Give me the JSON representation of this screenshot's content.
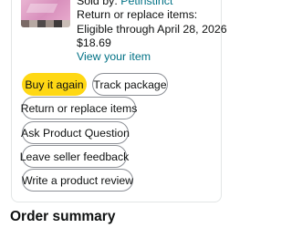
{
  "order_item": {
    "image_alt": "product-thumbnail",
    "sold_by_label": "Sold by: ",
    "seller_name": "Petinstinct",
    "return_line1": "Return or replace items:",
    "return_line2": "Eligible through April 28, 2026",
    "price": "$18.69",
    "view_item_label": "View your item",
    "thumbnail_stripe_colors": [
      "#7a6a66",
      "#b7a9a3",
      "#4f4a4a",
      "#9b8d87",
      "#3e3a3a",
      "#c9bdb6"
    ]
  },
  "actions": {
    "buy_again": "Buy it again",
    "track_package": "Track package",
    "return_replace": "Return or replace items",
    "ask_question": "Ask Product Question",
    "seller_feedback": "Leave seller feedback",
    "product_review": "Write a product review"
  },
  "order_summary": {
    "heading": "Order summary"
  },
  "colors": {
    "primary_button": "#ffd814",
    "link": "#007185",
    "button_border": "#8d9096"
  }
}
